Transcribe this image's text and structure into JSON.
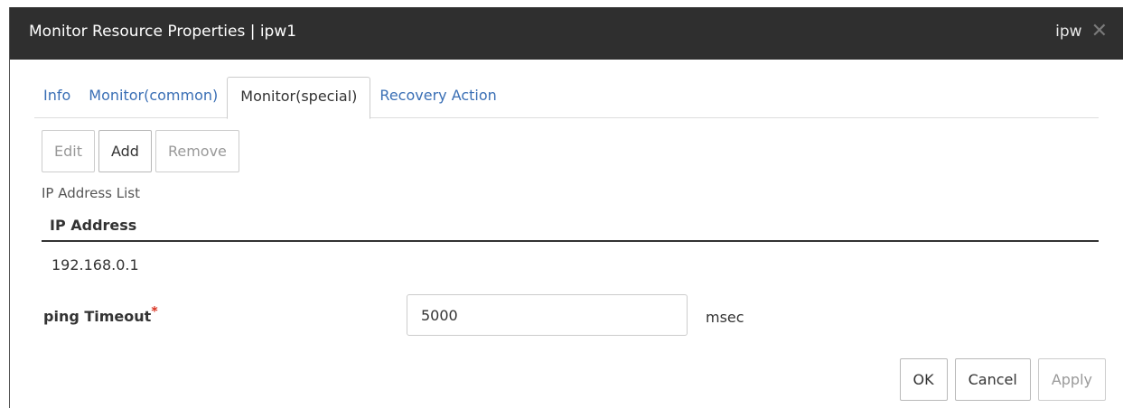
{
  "window": {
    "title": "Monitor Resource Properties | ipw1",
    "user": "ipw",
    "close_glyph": "✕"
  },
  "tabs": [
    {
      "label": "Info",
      "active": false
    },
    {
      "label": "Monitor(common)",
      "active": false
    },
    {
      "label": "Monitor(special)",
      "active": true
    },
    {
      "label": "Recovery Action",
      "active": false
    }
  ],
  "toolbar": {
    "edit_label": "Edit",
    "add_label": "Add",
    "remove_label": "Remove"
  },
  "ip_list": {
    "label": "IP Address List",
    "column_header": "IP Address",
    "rows": [
      "192.168.0.1"
    ]
  },
  "ping_timeout": {
    "label": "ping Timeout",
    "required_mark": "*",
    "value": "5000",
    "unit": "msec"
  },
  "footer": {
    "ok_label": "OK",
    "cancel_label": "Cancel",
    "apply_label": "Apply"
  },
  "colors": {
    "titlebar": "#2f2f2f",
    "tab_link": "#3a6fb5",
    "required": "#d9301e"
  },
  "icons": {
    "close": "close-icon"
  }
}
